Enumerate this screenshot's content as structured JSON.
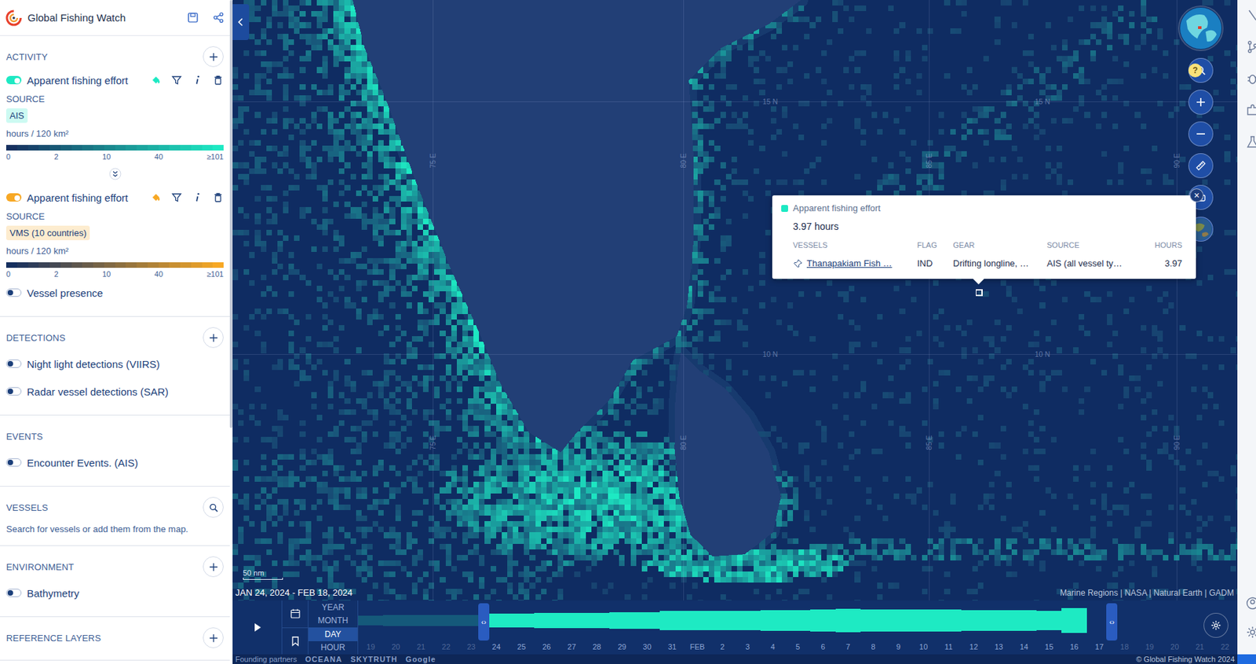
{
  "app": {
    "title": "Global Fishing Watch"
  },
  "sidebar": {
    "sections": [
      {
        "title": "ACTIVITY",
        "action": "add",
        "layers": [
          {
            "kind": "heatmap",
            "name": "Apparent fishing effort",
            "on": true,
            "color": "#1de9c3",
            "source_label": "SOURCE",
            "source": "AIS",
            "unit": "hours / 120 km²",
            "ticks": [
              "0",
              "2",
              "10",
              "40",
              "≥101"
            ]
          },
          {
            "kind": "heatmap",
            "name": "Apparent fishing effort",
            "on": true,
            "color": "#f7a825",
            "source_label": "SOURCE",
            "source": "VMS (10 countries)",
            "unit": "hours / 120 km²",
            "ticks": [
              "0",
              "2",
              "10",
              "40",
              "≥101"
            ]
          },
          {
            "kind": "simple",
            "name": "Vessel presence",
            "on": false
          }
        ]
      },
      {
        "title": "DETECTIONS",
        "action": "add",
        "layers": [
          {
            "kind": "simple",
            "name": "Night light detections (VIIRS)",
            "on": false
          },
          {
            "kind": "simple",
            "name": "Radar vessel detections (SAR)",
            "on": false
          }
        ]
      },
      {
        "title": "EVENTS",
        "action": "none",
        "layers": [
          {
            "kind": "simple",
            "name": "Encounter Events. (AIS)",
            "on": false
          }
        ]
      },
      {
        "title": "VESSELS",
        "action": "search",
        "layers": [],
        "hint": "Search for vessels or add them from the map."
      },
      {
        "title": "ENVIRONMENT",
        "action": "add",
        "layers": [
          {
            "kind": "simple",
            "name": "Bathymetry",
            "on": false
          }
        ]
      },
      {
        "title": "REFERENCE LAYERS",
        "action": "add",
        "layers": []
      }
    ]
  },
  "map": {
    "graticule": {
      "latitudes": [
        "15 N",
        "10 N"
      ],
      "longitudes": [
        "75 E",
        "80 E",
        "85 E",
        "90 E"
      ]
    },
    "date_range": "JAN 24, 2024 - FEB 18, 2024",
    "scale": "50 nm",
    "attribution": "Marine Regions | NASA | Natural Earth | GADM",
    "help": "?"
  },
  "tooltip": {
    "title": "Apparent fishing effort",
    "total": "3.97 hours",
    "columns": [
      "VESSELS",
      "FLAG",
      "GEAR",
      "SOURCE",
      "HOURS"
    ],
    "rows": [
      {
        "vessel": "Thanapakiam Fish …",
        "flag": "IND",
        "gear": "Drifting longline, …",
        "source": "AIS (all vessel ty…",
        "hours": "3.97"
      }
    ],
    "close": "×"
  },
  "timebar": {
    "handle": "‹›",
    "intervals": [
      {
        "label": "YEAR",
        "selected": false
      },
      {
        "label": "MONTH",
        "selected": false
      },
      {
        "label": "DAY",
        "selected": true
      },
      {
        "label": "HOUR",
        "selected": false
      }
    ],
    "days": [
      {
        "label": "19",
        "selected": false,
        "level": 0.35
      },
      {
        "label": "20",
        "selected": false,
        "level": 0.38
      },
      {
        "label": "21",
        "selected": false,
        "level": 0.4
      },
      {
        "label": "22",
        "selected": false,
        "level": 0.4
      },
      {
        "label": "23",
        "selected": false,
        "level": 0.42
      },
      {
        "label": "24",
        "selected": true,
        "level": 0.48
      },
      {
        "label": "25",
        "selected": true,
        "level": 0.52
      },
      {
        "label": "26",
        "selected": true,
        "level": 0.55
      },
      {
        "label": "27",
        "selected": true,
        "level": 0.55
      },
      {
        "label": "28",
        "selected": true,
        "level": 0.55
      },
      {
        "label": "29",
        "selected": true,
        "level": 0.58
      },
      {
        "label": "30",
        "selected": true,
        "level": 0.6
      },
      {
        "label": "31",
        "selected": true,
        "level": 0.72
      },
      {
        "label": "FEB",
        "selected": true,
        "level": 0.68
      },
      {
        "label": "2",
        "selected": true,
        "level": 0.68
      },
      {
        "label": "3",
        "selected": true,
        "level": 0.72
      },
      {
        "label": "4",
        "selected": true,
        "level": 0.74
      },
      {
        "label": "5",
        "selected": true,
        "level": 0.74
      },
      {
        "label": "6",
        "selected": true,
        "level": 0.8
      },
      {
        "label": "7",
        "selected": true,
        "level": 0.86
      },
      {
        "label": "8",
        "selected": true,
        "level": 0.8
      },
      {
        "label": "9",
        "selected": true,
        "level": 0.8
      },
      {
        "label": "10",
        "selected": true,
        "level": 0.8
      },
      {
        "label": "11",
        "selected": true,
        "level": 0.8
      },
      {
        "label": "12",
        "selected": true,
        "level": 0.76
      },
      {
        "label": "13",
        "selected": true,
        "level": 0.74
      },
      {
        "label": "14",
        "selected": true,
        "level": 0.74
      },
      {
        "label": "15",
        "selected": true,
        "level": 0.68
      },
      {
        "label": "16",
        "selected": true,
        "level": 0.88
      },
      {
        "label": "17",
        "selected": true,
        "level": 0
      },
      {
        "label": "18",
        "selected": false,
        "level": 0
      },
      {
        "label": "19",
        "selected": false,
        "level": 0
      },
      {
        "label": "20",
        "selected": false,
        "level": 0
      },
      {
        "label": "21",
        "selected": false,
        "level": 0
      },
      {
        "label": "22",
        "selected": false,
        "level": 0
      }
    ]
  },
  "footer": {
    "partners_label": "Founding partners",
    "partners": [
      "OCEANA",
      "SKYTRUTH",
      "Google"
    ],
    "copyright": "© Global Fishing Watch 2024"
  }
}
